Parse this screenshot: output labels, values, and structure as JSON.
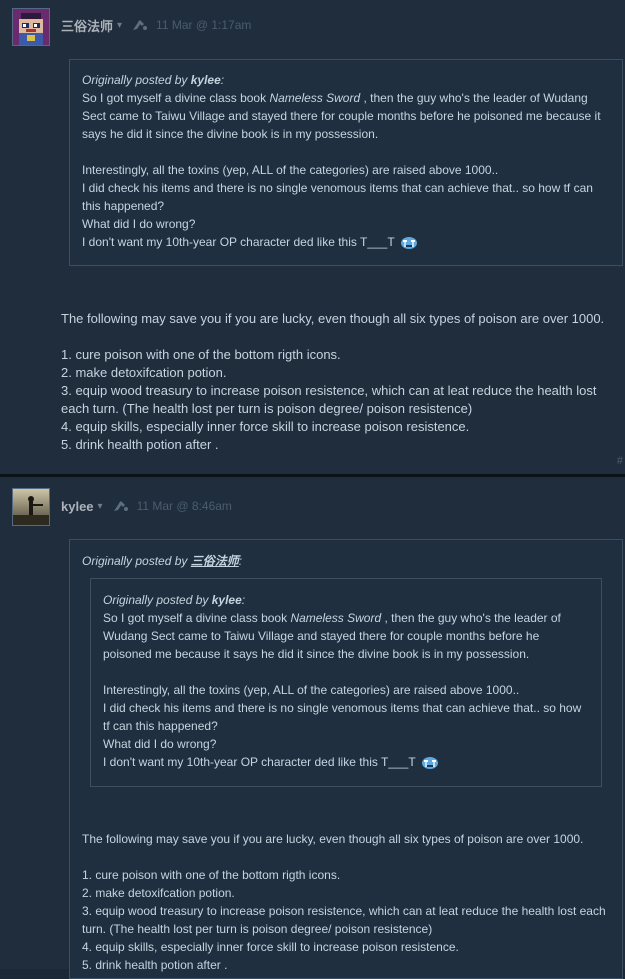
{
  "thread": [
    {
      "author": "三俗法师",
      "timestamp": "11 Mar @ 1:17am",
      "quote": {
        "prefix": "Originally posted by",
        "by": "kylee",
        "colon": ":",
        "lines_a": [
          "So I got myself a divine class book ",
          "Nameless Sword",
          " , then the guy who's the leader of Wudang Sect came to Taiwu Village and stayed there for couple months before he poisoned me because it says he did it since the divine book is in my possession."
        ],
        "lines_b": [
          "Interestingly, all the toxins (yep, ALL of the categories) are raised above 1000..",
          "I did check his items and there is no single venomous items that can achieve that.. so how tf can this happened?",
          "What did I do wrong?",
          "I don't want my 10th-year OP character ded like this T___T"
        ]
      },
      "body": [
        "The following may save you if you are lucky, even though all six types of poison are over 1000.",
        "1. cure poison with one of the bottom rigth icons.",
        "2. make detoxifcation potion.",
        "3. equip wood treasury to increase poison resistence, which can at leat reduce the health lost each turn. (The health lost per turn is poison degree/ poison resistence)",
        "4. equip skills, especially inner force skill to increase poison resistence.",
        "5. drink health potion after ."
      ],
      "corner_mark": "#"
    },
    {
      "author": "kylee",
      "timestamp": "11 Mar @ 8:46am",
      "quote": {
        "prefix": "Originally posted by",
        "by": "三俗法师",
        "colon": ":"
      },
      "body": [
        "The following may save you if you are lucky, even though all six types of poison are over 1000.",
        "1. cure poison with one of the bottom rigth icons.",
        "2. make detoxifcation potion.",
        "3. equip wood treasury to increase poison resistence, which can at leat reduce the health lost each turn. (The health lost per turn is poison degree/ poison resistence)",
        "4. equip skills, especially inner force skill to increase poison resistence.",
        "5. drink health potion after ."
      ]
    }
  ],
  "colors": {
    "page_bg": "#1b2838",
    "post_bg": "#1f2d3d",
    "quote_border": "#3c4e62",
    "text": "#c6d4df"
  }
}
